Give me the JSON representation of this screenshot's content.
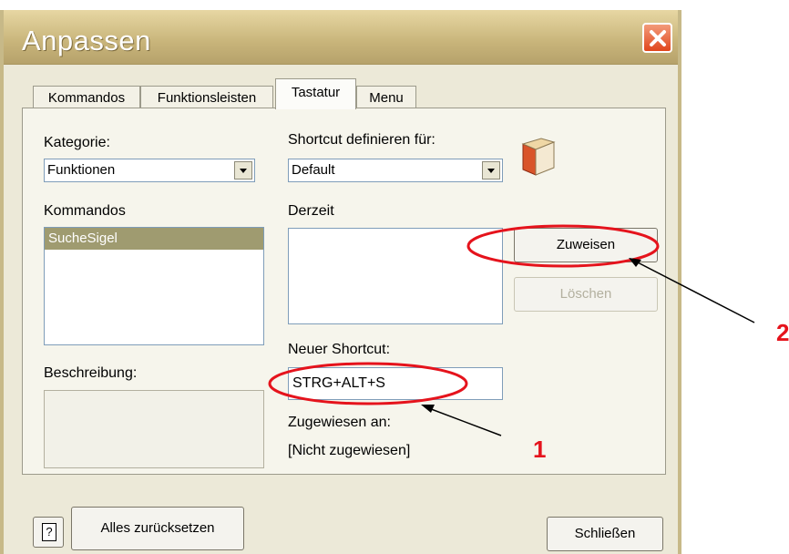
{
  "window": {
    "title": "Anpassen",
    "close_icon": "close-icon"
  },
  "tabs": [
    {
      "label": "Kommandos"
    },
    {
      "label": "Funktionsleisten"
    },
    {
      "label": "Tastatur"
    },
    {
      "label": "Menu"
    }
  ],
  "active_tab": "Tastatur",
  "category": {
    "label": "Kategorie:",
    "value": "Funktionen"
  },
  "commands": {
    "label": "Kommandos",
    "items": [
      "SucheSigel"
    ],
    "selected": "SucheSigel"
  },
  "description": {
    "label": "Beschreibung:"
  },
  "shortcut_for": {
    "label": "Shortcut definieren für:",
    "value": "Default"
  },
  "current": {
    "label": "Derzeit"
  },
  "new_shortcut": {
    "label": "Neuer Shortcut:",
    "value": "STRG+ALT+S"
  },
  "assigned_to": {
    "label": "Zugewiesen an:",
    "value": "[Nicht zugewiesen]"
  },
  "buttons": {
    "assign": "Zuweisen",
    "delete": "Löschen",
    "reset_all": "Alles zurücksetzen",
    "close": "Schließen"
  },
  "annotations": {
    "marker_1": "1",
    "marker_2": "2",
    "color": "#e5131c"
  },
  "colors": {
    "selection": "#9f9b70",
    "dialog_bg": "#ece9d8",
    "title_bar": "#c8b47a"
  }
}
